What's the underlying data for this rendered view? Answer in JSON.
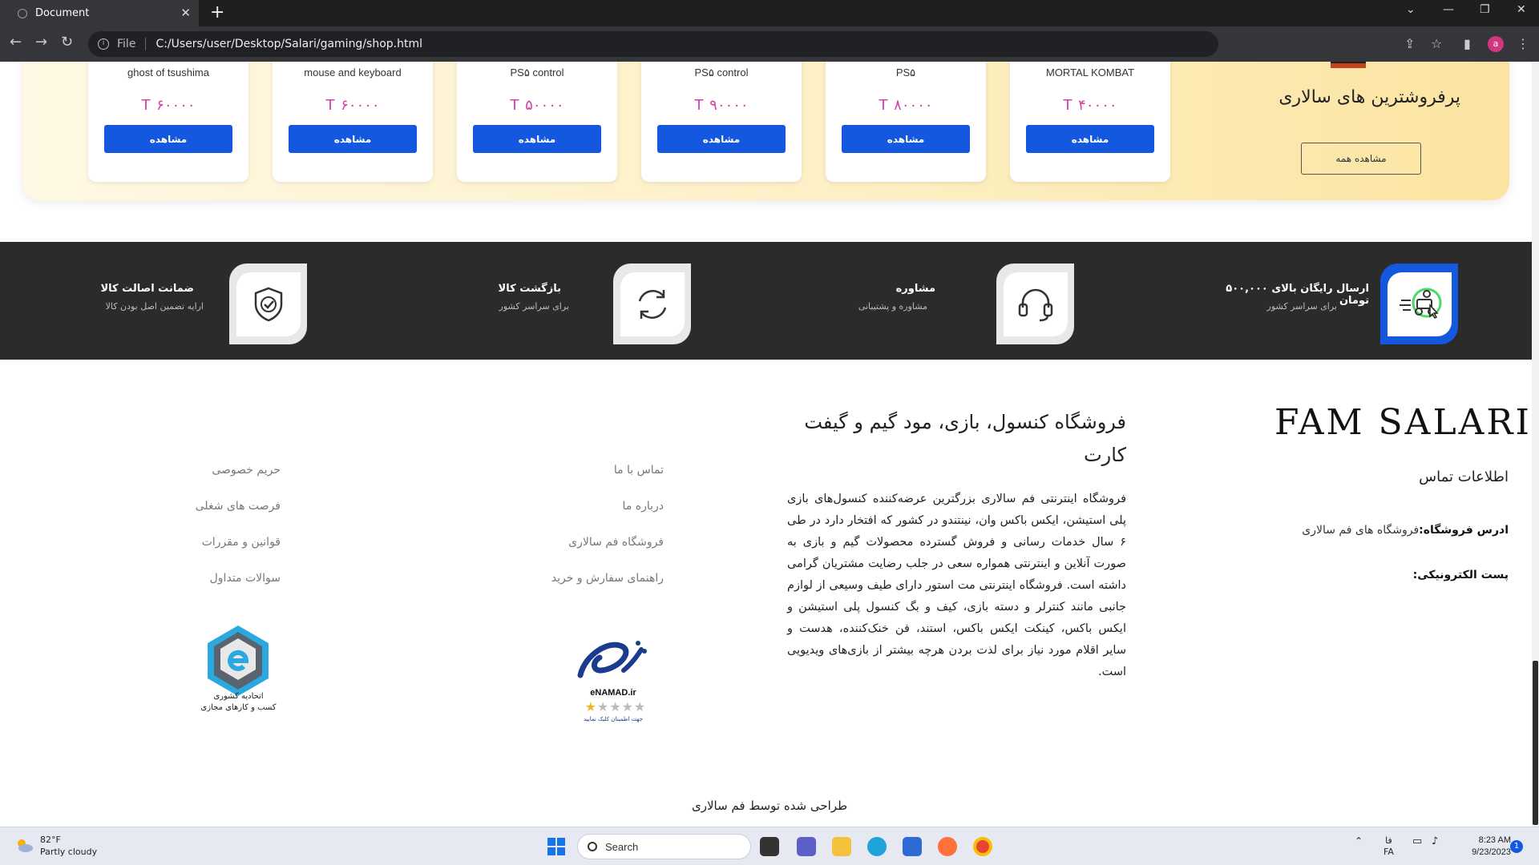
{
  "browser": {
    "tab_title": "Document",
    "url_scheme_label": "File",
    "url": "C:/Users/user/Desktop/Salari/gaming/shop.html",
    "profile_initial": "a"
  },
  "bestsellers": {
    "title": "پرفروشترین های سالاری",
    "view_all_label": "مشاهده همه",
    "products": [
      {
        "name": "ghost of tsushima",
        "price": "T ۶۰۰۰۰",
        "button": "مشاهده"
      },
      {
        "name": "mouse and keyboard",
        "price": "T ۶۰۰۰۰",
        "button": "مشاهده"
      },
      {
        "name": "PS۵ control",
        "price": "T ۵۰۰۰۰",
        "button": "مشاهده"
      },
      {
        "name": "PS۵ control",
        "price": "T ۹۰۰۰۰",
        "button": "مشاهده"
      },
      {
        "name": "PS۵",
        "price": "T ۸۰۰۰۰",
        "button": "مشاهده"
      },
      {
        "name": "MORTAL KOMBAT",
        "price": "T ۴۰۰۰۰",
        "button": "مشاهده"
      }
    ]
  },
  "features": [
    {
      "title": "ارسال رایگان بالای ۵۰۰,۰۰۰ تومان",
      "subtitle": "برای سراسر کشور",
      "icon": "delivery-icon"
    },
    {
      "title": "مشاوره",
      "subtitle": "مشاوره و پشتیبانی",
      "icon": "headset-icon"
    },
    {
      "title": "بازگشت کالا",
      "subtitle": "برای سراسر کشور",
      "icon": "return-icon"
    },
    {
      "title": "ضمانت اصالت کالا",
      "subtitle": "ارایه تضمین اصل بودن کالا",
      "icon": "shield-check-icon"
    }
  ],
  "footer": {
    "logo_text": "FAM SALARI",
    "contact_heading": "اطلاعات تماس",
    "address_label": "ادرس فروشگاه:",
    "address_value": "فروشگاه های فم سالاری",
    "email_label": "پست الکترونیکی:",
    "about_title": "فروشگاه کنسول، بازی، مود گیم و گیفت کارت",
    "about_text": "فروشگاه اینترنتی فم سالاری بزرگترین عرضه‌کننده کنسول‌های بازی پلی استیشن، ایکس باکس وان، نینتندو در کشور که افتخار دارد در طی ۶ سال خدمات رسانی و فروش گسترده محصولات گیم و بازی به صورت آنلاین و اینترنتی همواره سعی در جلب رضایت مشتریان گرامی داشته است. فروشگاه اینترنتی مت استور دارای طیف وسیعی از لوازم جانبی مانند کنترلر و دسته بازی، کیف و بگ کنسول پلی استیشن و ایکس باکس، کینکت ایکس باکس، استند، فن خنک‌کننده، هدست و سایر اقلام مورد نیاز برای لذت بردن هرچه بیشتر از بازی‌های ویدیویی است.",
    "links_col1": [
      "تماس با ما",
      "درباره ما",
      "فروشگاه فم سالاری",
      "راهنمای سفارش و خرید"
    ],
    "links_col2": [
      "حریم خصوصی",
      "فرصت های شغلی",
      "قوانین و مقررات",
      "سوالات متداول"
    ],
    "union_badge_line1": "اتحادیه کشوری",
    "union_badge_line2": "کسب و کارهای مجازی",
    "enamad_name": "eNAMAD.ir",
    "enamad_note": "جهت اطمینان کلیک نمایید",
    "credit": "طراحی شده توسط فم سالاری"
  },
  "taskbar": {
    "temperature": "82°F",
    "weather": "Partly cloudy",
    "search_placeholder": "Search",
    "lang_top": "فا",
    "lang_bottom": "FA",
    "time": "8:23 AM",
    "date": "9/23/2023",
    "notifications": "1"
  },
  "colors": {
    "accent": "#1558e0",
    "price": "#d63ea8",
    "feature_bg": "#2b2b2b"
  }
}
